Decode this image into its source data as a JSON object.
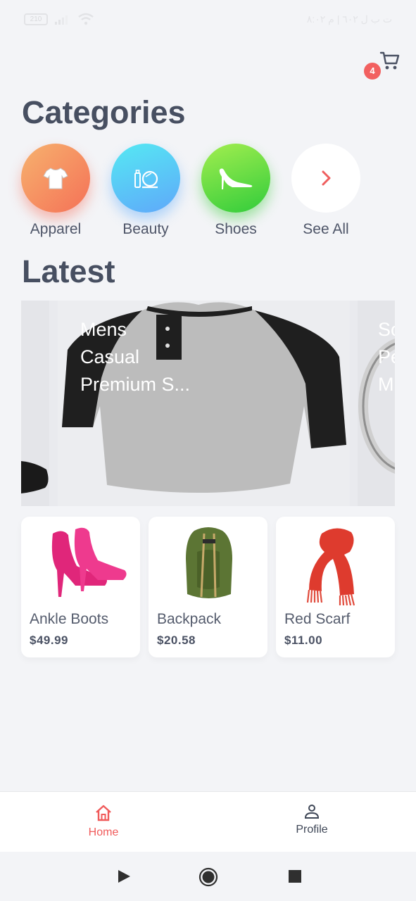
{
  "status_bar": {
    "battery": "210",
    "right_text": "ت ب ل ٦٠٢ | م ٨:٠٢"
  },
  "cart": {
    "badge_count": "4"
  },
  "categories_title": "Categories",
  "categories": [
    {
      "label": "Apparel",
      "icon": "tshirt-icon"
    },
    {
      "label": "Beauty",
      "icon": "mirror-icon"
    },
    {
      "label": "Shoes",
      "icon": "high-heel-icon"
    },
    {
      "label": "See All",
      "icon": "chevron-right-icon"
    }
  ],
  "latest_title": "Latest",
  "carousel": {
    "main_title_lines": [
      "Mens",
      "Casual",
      "Premium S..."
    ],
    "right_title_lines": [
      "So",
      "Pe",
      "M"
    ]
  },
  "products": [
    {
      "name": "Ankle Boots",
      "price": "$49.99"
    },
    {
      "name": "Backpack",
      "price": "$20.58"
    },
    {
      "name": "Red Scarf",
      "price": "$11.00"
    }
  ],
  "bottom_nav": {
    "home_label": "Home",
    "profile_label": "Profile"
  },
  "colors": {
    "accent": "#f05a5a",
    "background": "#f3f4f7",
    "heading": "#474f61"
  }
}
